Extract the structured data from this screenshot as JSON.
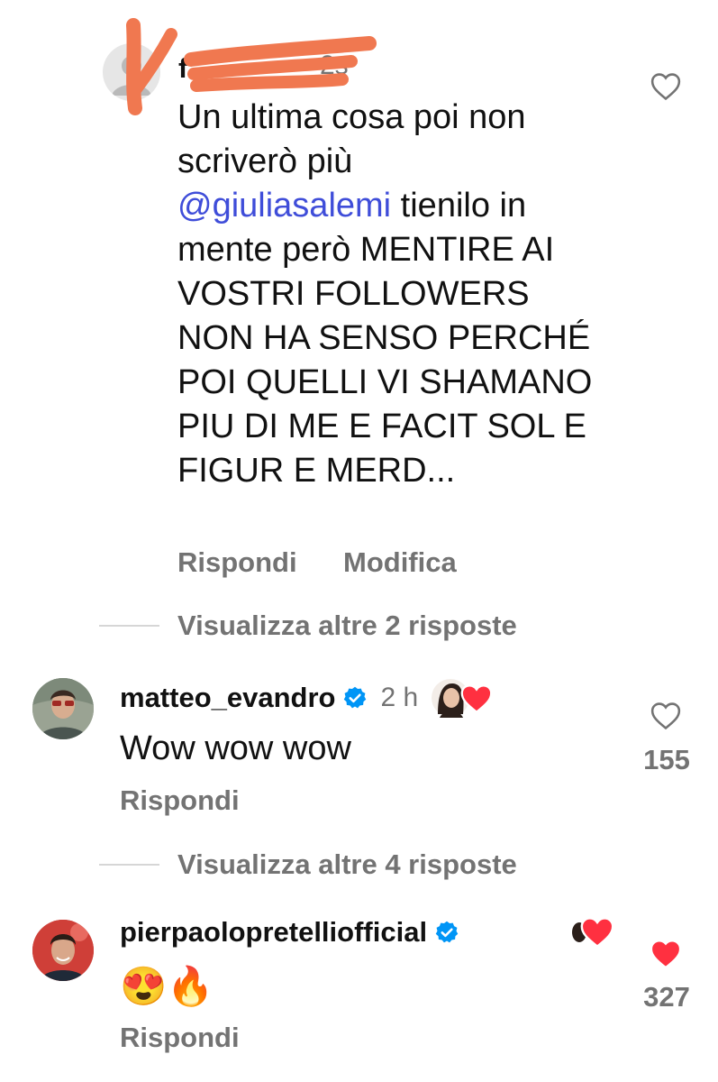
{
  "top_comment": {
    "username_visible": "f",
    "time": "2s",
    "text_before_mention": "Un ultima cosa poi non scriverò più",
    "mention": "@giuliasalemi",
    "text_after_mention": " tienilo in mente però MENTIRE AI VOSTRI FOLLOWERS NON HA SENSO PERCHÉ POI QUELLI VI SHAMANO PIU DI ME E FACIT SOL E FIGUR E MERD...",
    "reply_label": "Rispondi",
    "edit_label": "Modifica",
    "view_more_replies": "Visualizza altre 2 risposte"
  },
  "comments": [
    {
      "username": "matteo_evandro",
      "verified": true,
      "time": "2 h",
      "text": "Wow wow wow",
      "like_count": "155",
      "liked": false,
      "reply_label": "Rispondi",
      "view_more_replies": "Visualizza altre 4 risposte"
    },
    {
      "username": "pierpaolopretelliofficial",
      "verified": true,
      "time": "",
      "text": "😍🔥",
      "like_count": "327",
      "liked": true,
      "reply_label": "Rispondi"
    }
  ],
  "colors": {
    "accent_blue": "#3f4dd9",
    "verified_blue": "#0095f6",
    "like_red": "#ff3040",
    "muted_gray": "#737373",
    "scribble_orange": "#f07850"
  },
  "icons": {
    "like": "heart-outline-icon",
    "liked": "heart-filled-icon",
    "verified": "verified-badge-icon",
    "creator_like": "creator-liked-heart-icon"
  }
}
